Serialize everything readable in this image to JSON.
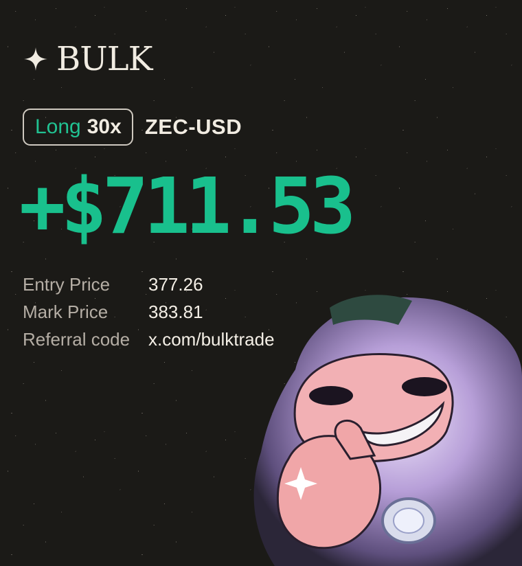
{
  "brand": {
    "name": "BULK",
    "icon": "sparkle-icon"
  },
  "position": {
    "side": "Long",
    "leverage": "30x",
    "pair": "ZEC-USD"
  },
  "pnl": "+$711.53",
  "details": [
    {
      "label": "Entry Price",
      "value": "377.26"
    },
    {
      "label": "Mark Price",
      "value": "383.81"
    },
    {
      "label": "Referral code",
      "value": "x.com/bulktrade"
    }
  ],
  "colors": {
    "background": "#1b1a17",
    "accent_green": "#19c08d",
    "text": "#f2ede4",
    "muted": "#b5aea5"
  }
}
